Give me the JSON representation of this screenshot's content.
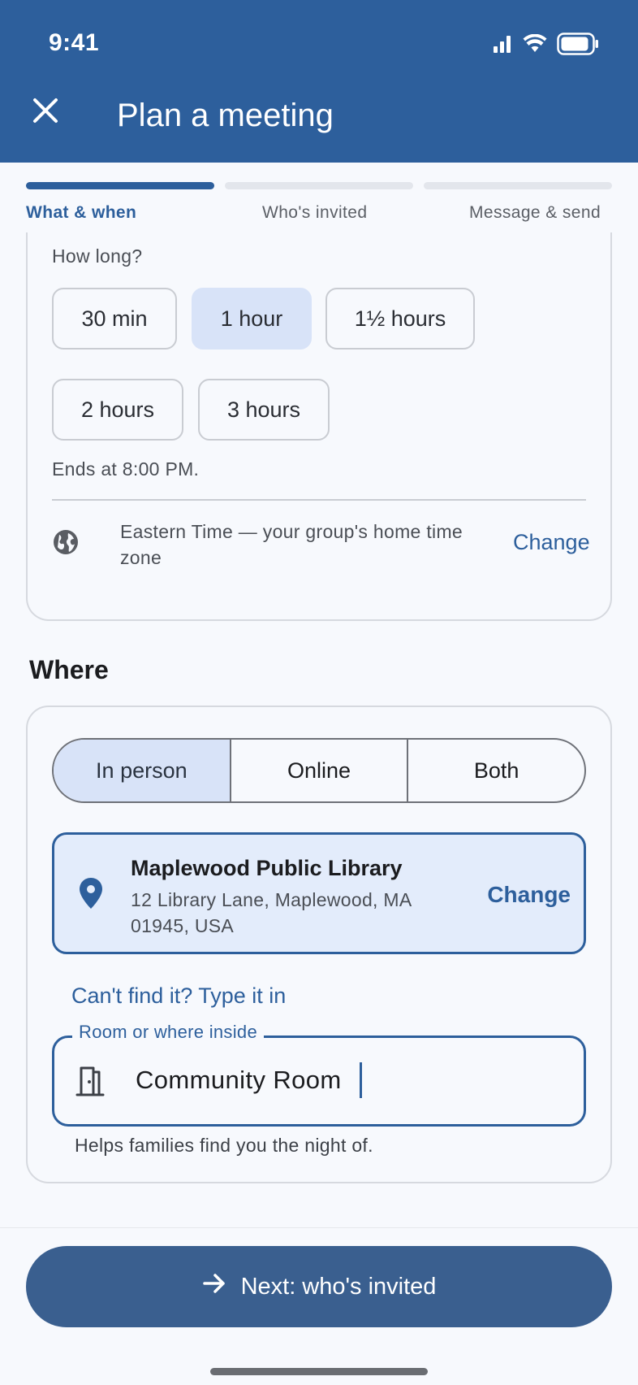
{
  "status_bar": {
    "time": "9:41"
  },
  "header": {
    "title": "Plan a meeting"
  },
  "stepper": {
    "steps": [
      {
        "label": "What & when",
        "active": true
      },
      {
        "label": "Who's invited",
        "active": false
      },
      {
        "label": "Message & send",
        "active": false
      }
    ]
  },
  "duration": {
    "label": "How long?",
    "options": [
      "30 min",
      "1 hour",
      "1½ hours",
      "2 hours",
      "3 hours"
    ],
    "selected": "1 hour",
    "ends_text": "Ends at 8:00 PM."
  },
  "timezone": {
    "text": "Eastern Time — your group's home time zone",
    "change_label": "Change"
  },
  "where": {
    "title": "Where",
    "modes": [
      "In person",
      "Online",
      "Both"
    ],
    "selected_mode": "In person",
    "place": {
      "name": "Maplewood Public Library",
      "address": "12 Library Lane, Maplewood, MA 01945, USA",
      "change_label": "Change"
    },
    "typein_link": "Can't find it? Type it in",
    "room_field": {
      "label": "Room or where inside",
      "value": "Community Room",
      "helper": "Helps families find you the night of."
    }
  },
  "footer": {
    "next_label": "Next: who's invited"
  },
  "colors": {
    "primary": "#2d5f9c",
    "button": "#3a5f8f",
    "selected_fill": "#d8e3f8",
    "background": "#f7f9fd"
  }
}
